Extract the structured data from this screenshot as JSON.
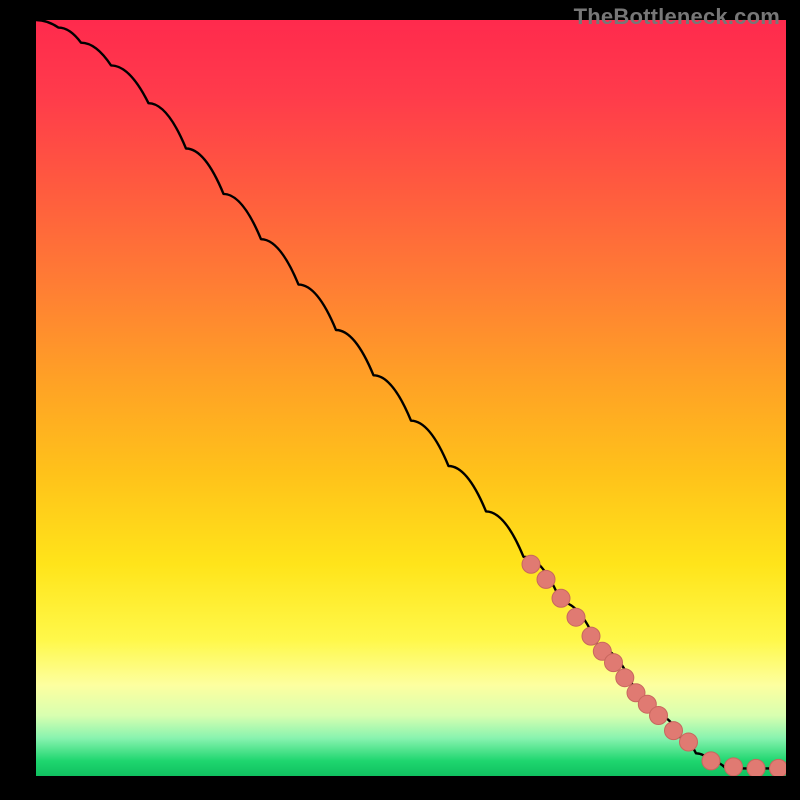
{
  "watermark": "TheBottleneck.com",
  "colors": {
    "gradient_stops": [
      {
        "offset": 0.0,
        "color": "#ff2a4d"
      },
      {
        "offset": 0.1,
        "color": "#ff3b4b"
      },
      {
        "offset": 0.22,
        "color": "#ff5a3f"
      },
      {
        "offset": 0.35,
        "color": "#ff7d34"
      },
      {
        "offset": 0.48,
        "color": "#ffa225"
      },
      {
        "offset": 0.6,
        "color": "#ffc21a"
      },
      {
        "offset": 0.72,
        "color": "#ffe41a"
      },
      {
        "offset": 0.82,
        "color": "#fff84a"
      },
      {
        "offset": 0.88,
        "color": "#fdffa0"
      },
      {
        "offset": 0.92,
        "color": "#d8ffb0"
      },
      {
        "offset": 0.95,
        "color": "#88f3af"
      },
      {
        "offset": 0.98,
        "color": "#1fd66f"
      },
      {
        "offset": 1.0,
        "color": "#10c060"
      }
    ],
    "curve": "#000000",
    "dot_fill": "#e07a72",
    "dot_stroke": "#c8665e"
  },
  "chart_data": {
    "type": "line",
    "title": "",
    "xlabel": "",
    "ylabel": "",
    "xlim": [
      0,
      100
    ],
    "ylim": [
      0,
      100
    ],
    "series": [
      {
        "name": "bottleneck-curve",
        "x": [
          0,
          3,
          6,
          10,
          15,
          20,
          25,
          30,
          35,
          40,
          45,
          50,
          55,
          60,
          65,
          70,
          75,
          80,
          83,
          86,
          88,
          90,
          92,
          95,
          100
        ],
        "y": [
          100,
          99,
          97,
          94,
          89,
          83,
          77,
          71,
          65,
          59,
          53,
          47,
          41,
          35,
          29,
          23,
          17,
          11,
          8,
          5,
          3,
          2,
          1,
          1,
          1
        ]
      }
    ],
    "highlight_points": {
      "name": "segment-dots",
      "x": [
        66,
        68,
        70,
        72,
        74,
        75.5,
        77,
        78.5,
        80,
        81.5,
        83,
        85,
        87,
        90,
        93,
        96,
        99
      ],
      "y": [
        28,
        26,
        23.5,
        21,
        18.5,
        16.5,
        15,
        13,
        11,
        9.5,
        8,
        6,
        4.5,
        2,
        1.2,
        1,
        1
      ]
    }
  }
}
